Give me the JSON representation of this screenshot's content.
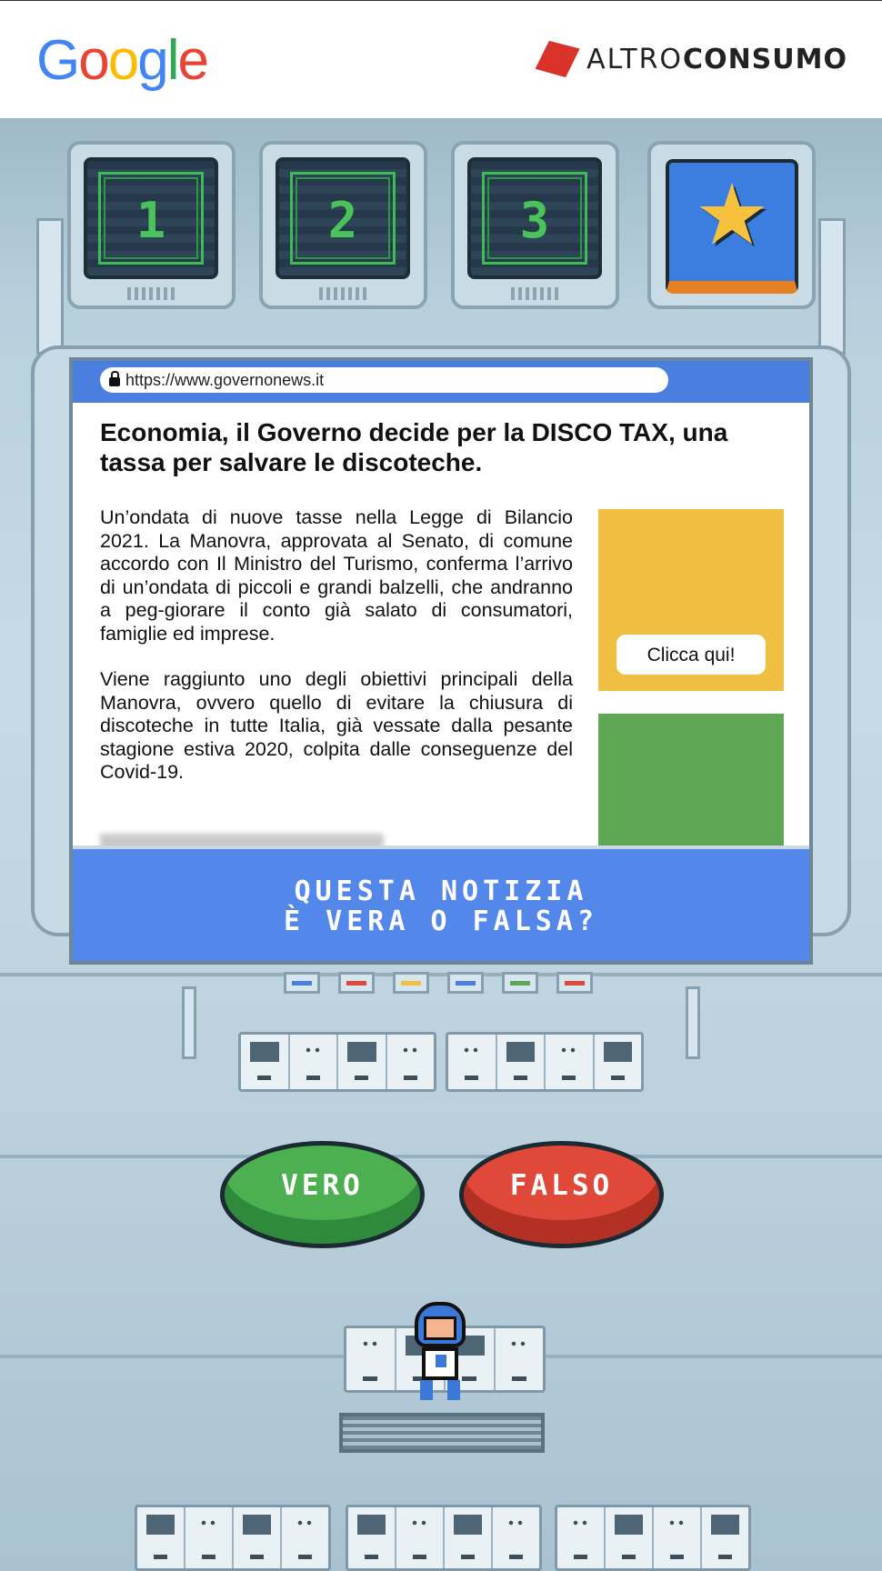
{
  "header": {
    "google_logo": {
      "letters": [
        {
          "char": "G",
          "color": "#4285F4"
        },
        {
          "char": "o",
          "color": "#EA4335"
        },
        {
          "char": "o",
          "color": "#FBBC05"
        },
        {
          "char": "g",
          "color": "#4285F4"
        },
        {
          "char": "l",
          "color": "#34A853"
        },
        {
          "char": "e",
          "color": "#EA4335"
        }
      ]
    },
    "altroconsumo_logo": {
      "part1": "ALTRO",
      "part2": "CONSUMO",
      "mark_color": "#d8322b"
    }
  },
  "levels": [
    {
      "label": "1"
    },
    {
      "label": "2"
    },
    {
      "label": "3"
    },
    {
      "icon": "star-icon"
    }
  ],
  "browser": {
    "url": "https://www.governonews.it",
    "headline": "Economia, il Governo decide per la DISCO TAX, una tassa per salvare le discoteche.",
    "paragraphs": [
      "Un’ondata di nuove tasse nella Legge di Bilancio 2021. La Manovra, approvata al Senato, di comune accordo con Il Ministro del Turismo, conferma l’arrivo di un’ondata di piccoli e grandi balzelli, che andranno a peg-giorare il conto già salato di consumatori, famiglie ed imprese.",
      "Viene raggiunto uno degli obiettivi principali della Manovra, ovvero quello di evitare la chiusura di discoteche in tutte Italia, già vessate dalla pesante stagione estiva 2020, colpita dalle conseguenze del Covid-19."
    ],
    "ad_button": "Clicca qui!"
  },
  "question": {
    "line1": "QUESTA NOTIZIA",
    "line2": "È VERA O FALSA?"
  },
  "buttons": {
    "true_label": "VERO",
    "false_label": "FALSO"
  },
  "colors": {
    "question_bar": "#5387ea",
    "true_button": "#4caf50",
    "false_button": "#e0493a",
    "star_box": "#3b7ee0",
    "indicator_lights": [
      "#4a7fe0",
      "#e0493a",
      "#f0bf41",
      "#4a7fe0",
      "#5fa655",
      "#e0493a"
    ]
  }
}
